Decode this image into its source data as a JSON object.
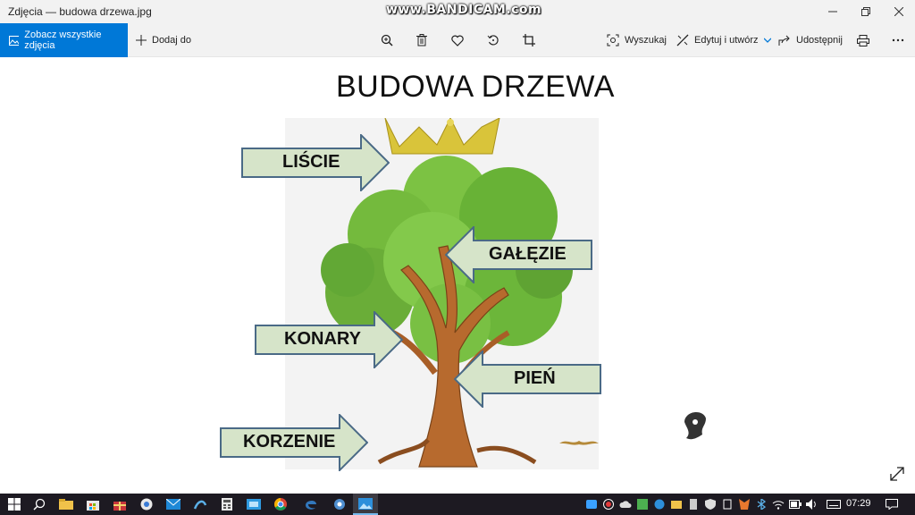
{
  "window": {
    "title": "Zdjęcia — budowa drzewa.jpg",
    "watermark": "www.BANDICAM.com"
  },
  "toolbar": {
    "see_all_label": "Zobacz wszystkie zdjęcia",
    "add_to_label": "Dodaj do",
    "search_label": "Wyszukaj",
    "edit_label": "Edytuj i utwórz",
    "share_label": "Udostępnij"
  },
  "image": {
    "heading": "BUDOWA DRZEWA",
    "labels": {
      "leaves": "LIŚCIE",
      "branches": "GAŁĘZIE",
      "boughs": "KONARY",
      "trunk": "PIEŃ",
      "roots": "KORZENIE"
    }
  },
  "taskbar": {
    "clock": "07:29"
  },
  "colors": {
    "accent": "#0078d7",
    "arrow_fill": "#d6e4c9",
    "arrow_border": "#4a6a86",
    "taskbar": "#1d1a22"
  }
}
